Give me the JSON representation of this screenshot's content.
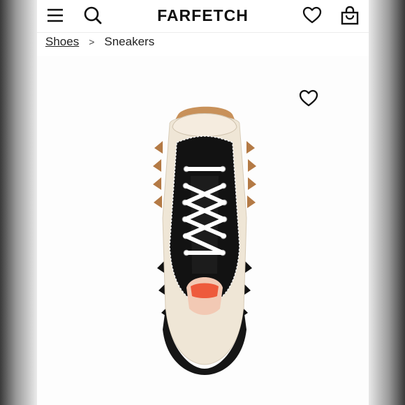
{
  "header": {
    "logo": "FARFETCH",
    "icons": [
      "menu-icon",
      "search-icon",
      "heart-icon",
      "bag-icon"
    ]
  },
  "breadcrumb": {
    "parent": "Shoes",
    "separator": ">",
    "current": "Sneakers"
  },
  "product": {
    "image_subject": "sneaker-image",
    "wishlist_icon": "heart-icon"
  }
}
